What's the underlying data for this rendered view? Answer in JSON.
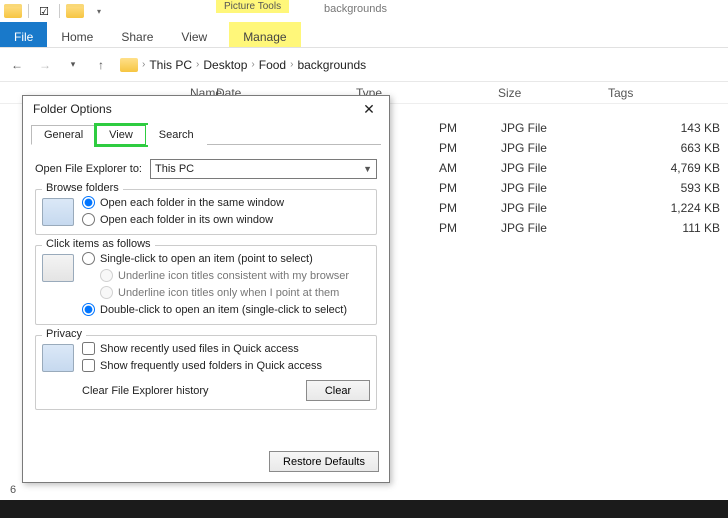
{
  "explorer": {
    "page_title": "backgrounds",
    "context_tools_label": "Picture Tools",
    "ribbon": {
      "file": "File",
      "home": "Home",
      "share": "Share",
      "view": "View",
      "manage": "Manage"
    },
    "breadcrumbs": [
      "This PC",
      "Desktop",
      "Food",
      "backgrounds"
    ],
    "columns": {
      "name": "Name",
      "date": "Date",
      "type": "Type",
      "size": "Size",
      "tags": "Tags"
    },
    "rows": [
      {
        "date_suffix": "PM",
        "type": "JPG File",
        "size": "143 KB"
      },
      {
        "date_suffix": "PM",
        "type": "JPG File",
        "size": "663 KB"
      },
      {
        "date_suffix": "AM",
        "type": "JPG File",
        "size": "4,769 KB"
      },
      {
        "date_suffix": "PM",
        "type": "JPG File",
        "size": "593 KB"
      },
      {
        "date_suffix": "PM",
        "type": "JPG File",
        "size": "1,224 KB"
      },
      {
        "date_suffix": "PM",
        "type": "JPG File",
        "size": "111 KB"
      }
    ],
    "status_count": "6"
  },
  "dialog": {
    "title": "Folder Options",
    "tabs": {
      "general": "General",
      "view": "View",
      "search": "Search"
    },
    "open_explorer_label": "Open File Explorer to:",
    "open_explorer_value": "This PC",
    "browse": {
      "legend": "Browse folders",
      "same_window": "Open each folder in the same window",
      "own_window": "Open each folder in its own window"
    },
    "click": {
      "legend": "Click items as follows",
      "single": "Single-click to open an item (point to select)",
      "underline_browser": "Underline icon titles consistent with my browser",
      "underline_point": "Underline icon titles only when I point at them",
      "double": "Double-click to open an item (single-click to select)"
    },
    "privacy": {
      "legend": "Privacy",
      "recent_files": "Show recently used files in Quick access",
      "frequent_folders": "Show frequently used folders in Quick access",
      "clear_label": "Clear File Explorer history",
      "clear_btn": "Clear"
    },
    "restore_defaults": "Restore Defaults"
  }
}
